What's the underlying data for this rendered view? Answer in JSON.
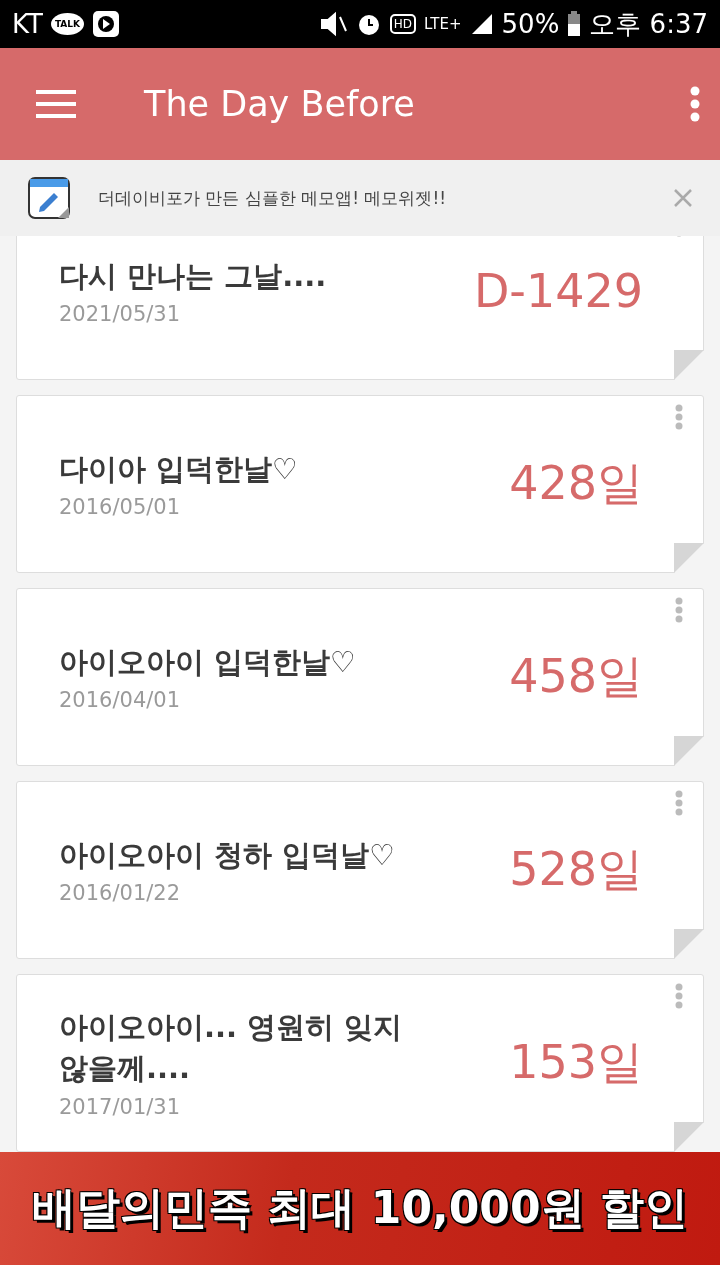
{
  "status_bar": {
    "carrier": "KT",
    "talk_badge": "TALK",
    "hd_badge": "HD",
    "network": "LTE+",
    "battery": "50%",
    "time": "오후 6:37"
  },
  "app_bar": {
    "title": "The Day Before"
  },
  "notice": {
    "text": "더데이비포가 만든 심플한 메모앱! 메모위젯!!"
  },
  "events": [
    {
      "title": "다시 만나는 그날....",
      "date": "2021/05/31",
      "count": "D-1429"
    },
    {
      "title": "다이아 입덕한날♡",
      "date": "2016/05/01",
      "count": "428일"
    },
    {
      "title": "아이오아이 입덕한날♡",
      "date": "2016/04/01",
      "count": "458일"
    },
    {
      "title": "아이오아이 청하 입덕날♡",
      "date": "2016/01/22",
      "count": "528일"
    },
    {
      "title": "아이오아이... 영원히 잊지 않을께....",
      "date": "2017/01/31",
      "count": "153일"
    }
  ],
  "ad_banner": {
    "text": "배달의민족 최대 10,000원 할인"
  }
}
